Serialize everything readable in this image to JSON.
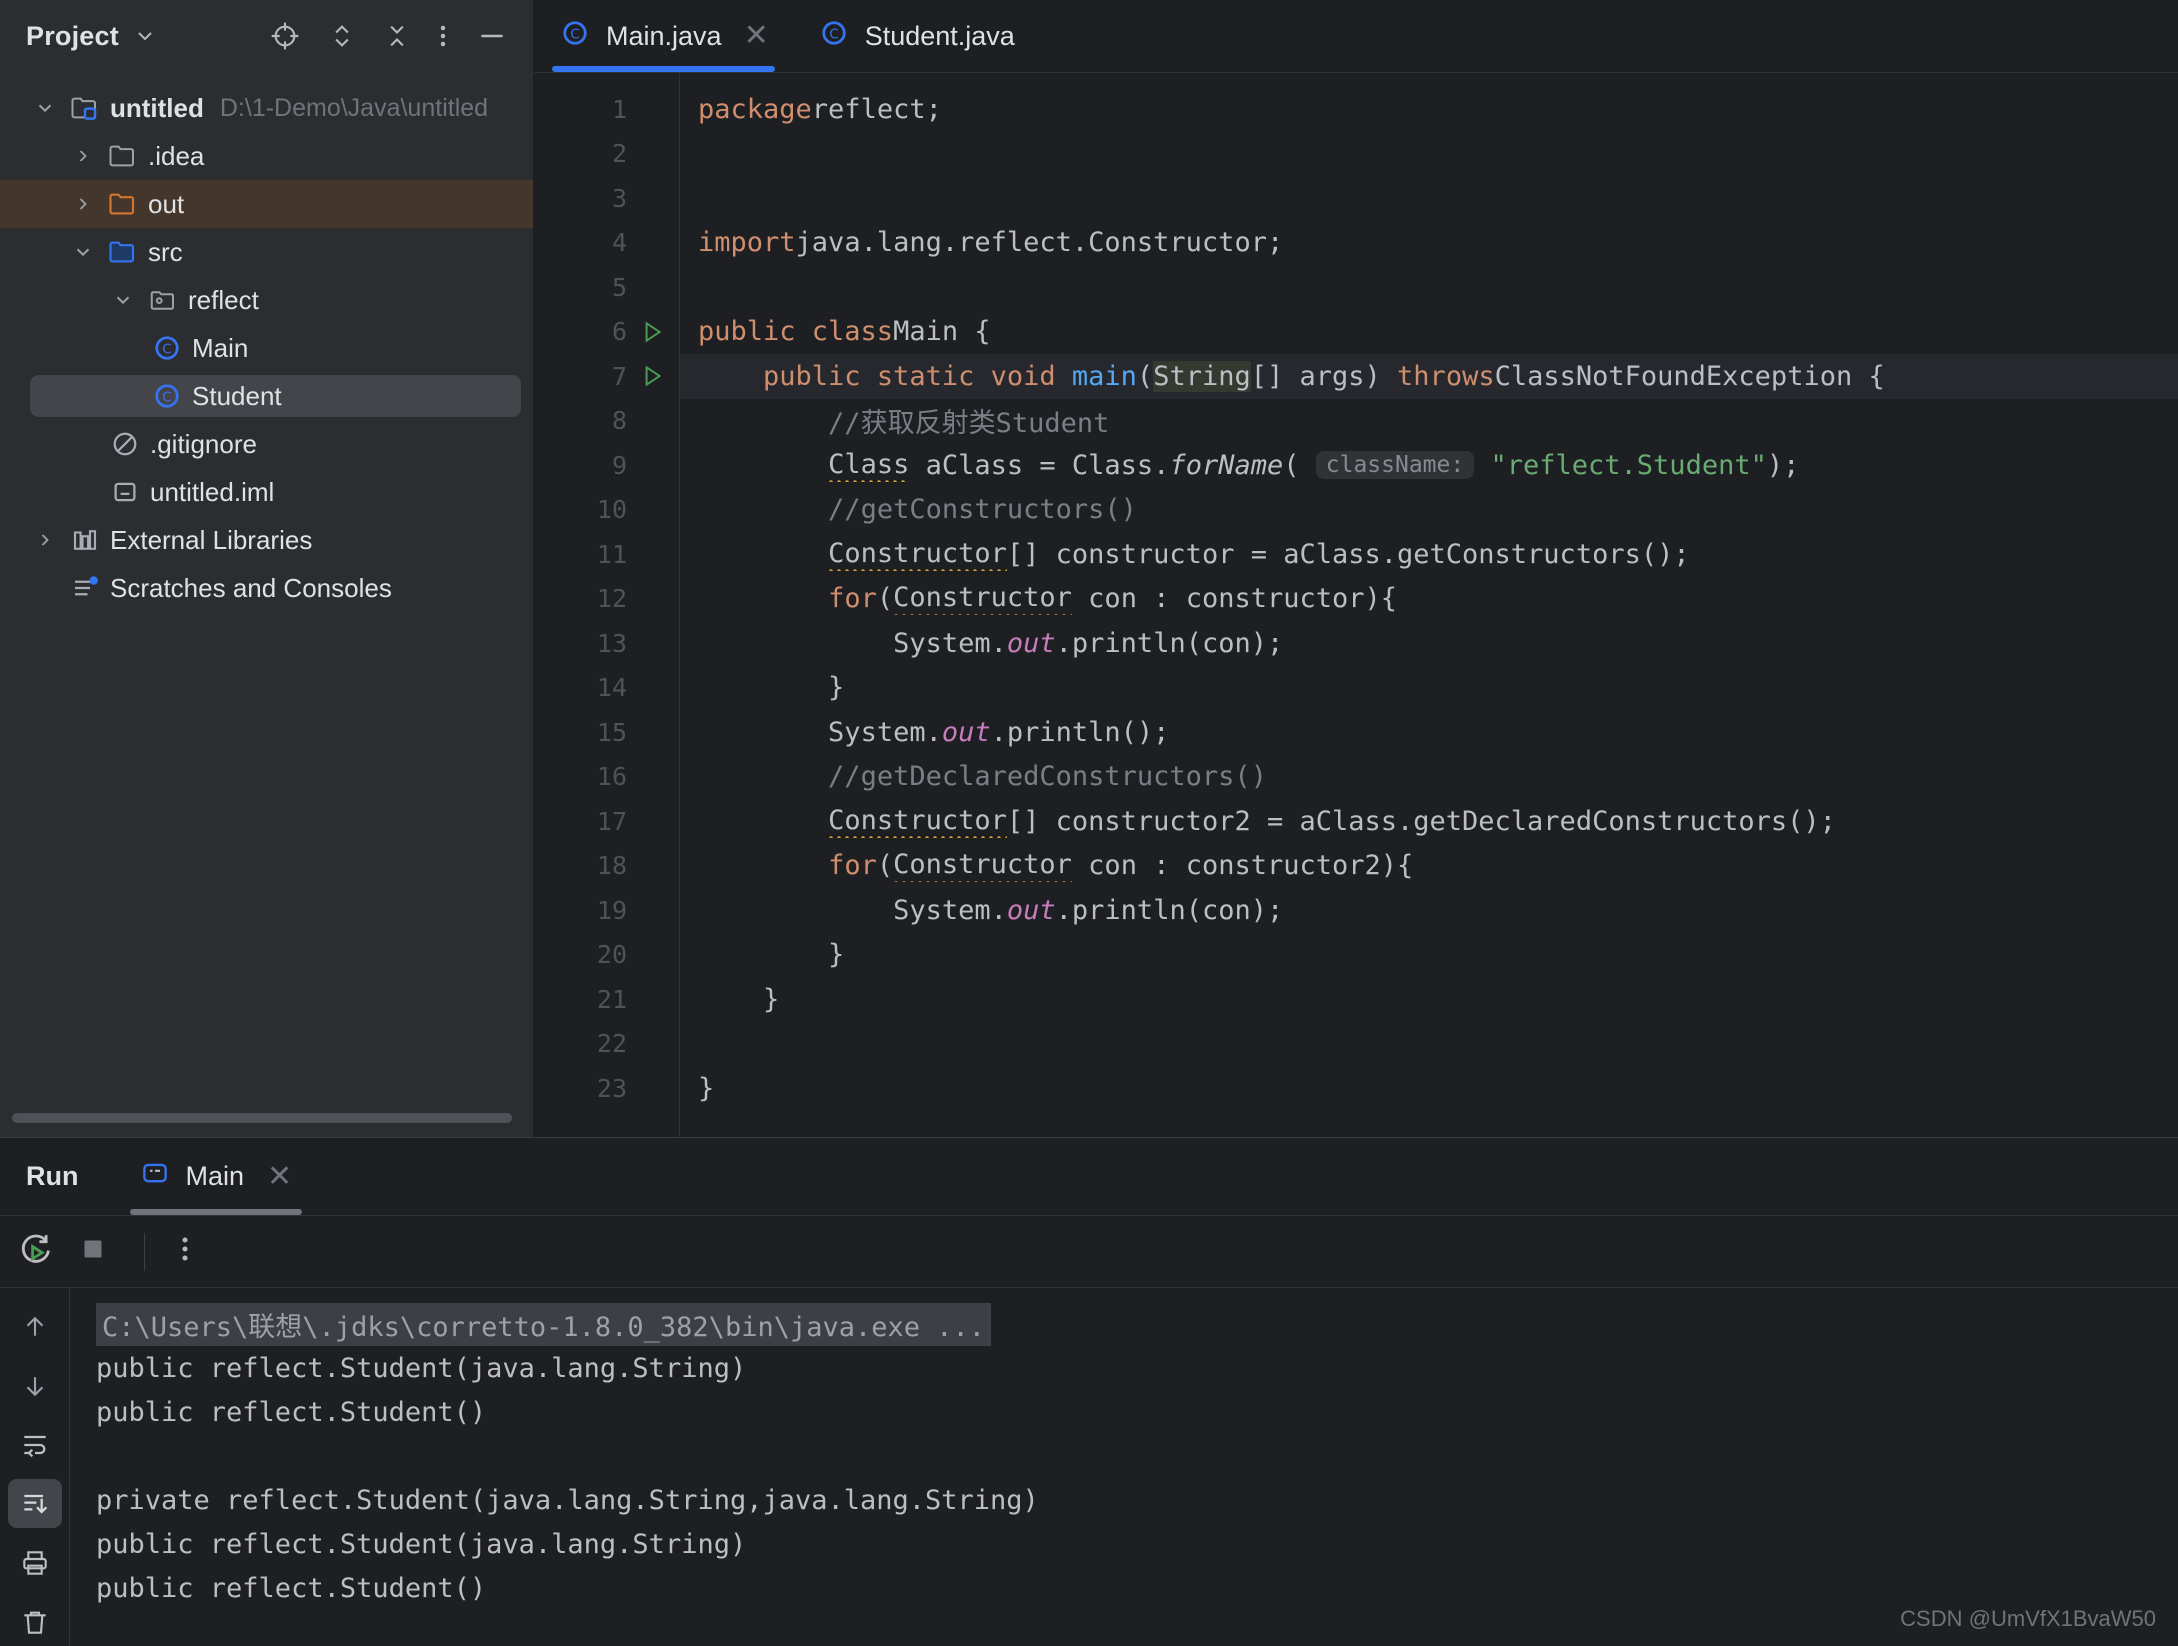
{
  "sidebar": {
    "title": "Project",
    "tools": [
      {
        "name": "locate-icon",
        "label": "Select Opened File"
      },
      {
        "name": "expand-collapse-icon",
        "label": "Expand or Collapse"
      },
      {
        "name": "collapse-all-icon",
        "label": "Collapse All"
      },
      {
        "name": "more-options-icon",
        "label": "Options"
      },
      {
        "name": "hide-icon",
        "label": "Hide"
      }
    ],
    "tree": [
      {
        "label": "untitled",
        "sub": "D:\\1-Demo\\Java\\untitled",
        "icon": "module-folder-icon",
        "arrow": "down",
        "indent": 0,
        "bold": true,
        "state": "normal"
      },
      {
        "label": ".idea",
        "sub": "",
        "icon": "folder-icon",
        "arrow": "right",
        "indent": 1,
        "bold": false,
        "state": "normal"
      },
      {
        "label": "out",
        "sub": "",
        "icon": "folder-excluded-icon",
        "arrow": "right",
        "indent": 1,
        "bold": false,
        "state": "excluded"
      },
      {
        "label": "src",
        "sub": "",
        "icon": "folder-source-icon",
        "arrow": "down",
        "indent": 1,
        "bold": false,
        "state": "normal"
      },
      {
        "label": "reflect",
        "sub": "",
        "icon": "package-icon",
        "arrow": "down",
        "indent": 2,
        "bold": false,
        "state": "normal"
      },
      {
        "label": "Main",
        "sub": "",
        "icon": "java-class-icon",
        "arrow": "none",
        "indent": 3,
        "bold": false,
        "state": "normal"
      },
      {
        "label": "Student",
        "sub": "",
        "icon": "java-class-icon",
        "arrow": "none",
        "indent": 3,
        "bold": false,
        "state": "selected"
      },
      {
        "label": ".gitignore",
        "sub": "",
        "icon": "gitignore-icon",
        "arrow": "none",
        "indent": 2,
        "bold": false,
        "state": "normal"
      },
      {
        "label": "untitled.iml",
        "sub": "",
        "icon": "iml-file-icon",
        "arrow": "none",
        "indent": 2,
        "bold": false,
        "state": "normal"
      },
      {
        "label": "External Libraries",
        "sub": "",
        "icon": "library-icon",
        "arrow": "right",
        "indent": 1,
        "bold": false,
        "state": "normal"
      },
      {
        "label": "Scratches and Consoles",
        "sub": "",
        "icon": "scratches-icon",
        "arrow": "none",
        "indent": 1,
        "bold": false,
        "state": "normal"
      }
    ]
  },
  "editor": {
    "tabs": [
      {
        "label": "Main.java",
        "icon": "java-class-icon",
        "active": true,
        "closable": true
      },
      {
        "label": "Student.java",
        "icon": "java-class-icon",
        "active": false,
        "closable": false
      }
    ],
    "line_numbers": [
      "1",
      "2",
      "3",
      "4",
      "5",
      "6",
      "7",
      "8",
      "9",
      "10",
      "11",
      "12",
      "13",
      "14",
      "15",
      "16",
      "17",
      "18",
      "19",
      "20",
      "21",
      "22",
      "23"
    ],
    "run_gutter_lines": [
      6,
      7
    ],
    "current_line": 7,
    "code_lines": [
      "package reflect;",
      "",
      "",
      "import java.lang.reflect.Constructor;",
      "",
      "public class Main {",
      "    public static void main(String[] args) throws ClassNotFoundException {",
      "        //获取反射类Student",
      "        Class aClass = Class.forName( className: \"reflect.Student\");",
      "        //getConstructors()",
      "        Constructor[] constructor = aClass.getConstructors();",
      "        for(Constructor con : constructor){",
      "            System.out.println(con);",
      "        }",
      "        System.out.println();",
      "        //getDeclaredConstructors()",
      "        Constructor[] constructor2 = aClass.getDeclaredConstructors();",
      "        for(Constructor con : constructor2){",
      "            System.out.println(con);",
      "        }",
      "    }",
      "",
      "}"
    ],
    "inlay_hint": "className:"
  },
  "run_panel": {
    "title": "Run",
    "tab_label": "Main",
    "tab_icon": "run-config-icon",
    "toolbar": [
      {
        "name": "rerun-icon",
        "label": "Rerun"
      },
      {
        "name": "stop-icon",
        "label": "Stop"
      },
      {
        "name": "more-options-icon",
        "label": "More"
      }
    ],
    "side_buttons": [
      {
        "name": "scroll-up-icon",
        "label": "Up",
        "active": false
      },
      {
        "name": "scroll-down-icon",
        "label": "Down",
        "active": false
      },
      {
        "name": "soft-wrap-icon",
        "label": "Soft-Wrap",
        "active": false
      },
      {
        "name": "scroll-to-end-icon",
        "label": "Scroll to End",
        "active": true
      },
      {
        "name": "print-icon",
        "label": "Print",
        "active": false
      },
      {
        "name": "clear-all-icon",
        "label": "Clear All",
        "active": false
      }
    ],
    "console_lines": [
      {
        "text": "C:\\Users\\联想\\.jdks\\corretto-1.8.0_382\\bin\\java.exe ...",
        "style": "command"
      },
      {
        "text": "public reflect.Student(java.lang.String)",
        "style": "normal"
      },
      {
        "text": "public reflect.Student()",
        "style": "normal"
      },
      {
        "text": "",
        "style": "normal"
      },
      {
        "text": "private reflect.Student(java.lang.String,java.lang.String)",
        "style": "normal"
      },
      {
        "text": "public reflect.Student(java.lang.String)",
        "style": "normal"
      },
      {
        "text": "public reflect.Student()",
        "style": "normal"
      }
    ]
  },
  "watermark": "CSDN @UmVfX1BvaW50",
  "colors": {
    "accent": "#3574F0",
    "keyword": "#CF8E6D",
    "string": "#6AAB73",
    "comment": "#7A7E85",
    "method": "#56A8F5",
    "excluded": "#45362B",
    "panel_bg": "#2B2D30",
    "editor_bg": "#1E1F22"
  }
}
